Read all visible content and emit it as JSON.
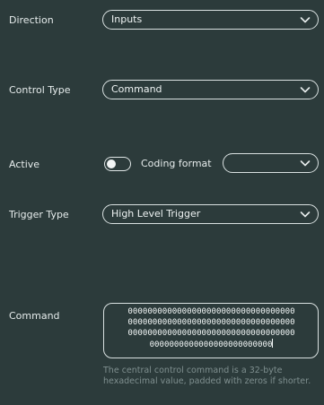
{
  "fields": {
    "direction": {
      "label": "Direction",
      "value": "Inputs"
    },
    "control_type": {
      "label": "Control Type",
      "value": "Command"
    },
    "active": {
      "label": "Active",
      "toggle_on": false
    },
    "coding_format": {
      "label": "Coding format",
      "value": ""
    },
    "trigger_type": {
      "label": "Trigger Type",
      "value": "High Level Trigger"
    },
    "command": {
      "label": "Command",
      "lines": [
        "0000000000000000000000000000000000",
        "0000000000000000000000000000000000",
        "0000000000000000000000000000000000",
        "0000000000000000000000000"
      ],
      "help": "The central control command is a 32-byte hexadecimal value, padded with zeros if shorter."
    }
  },
  "icons": {
    "dropdown": "chevron-down-icon"
  },
  "colors": {
    "background": "#2c3b3b",
    "border": "#d9e1e1",
    "text": "#e6ecec",
    "help_text": "#7f8f8f"
  }
}
